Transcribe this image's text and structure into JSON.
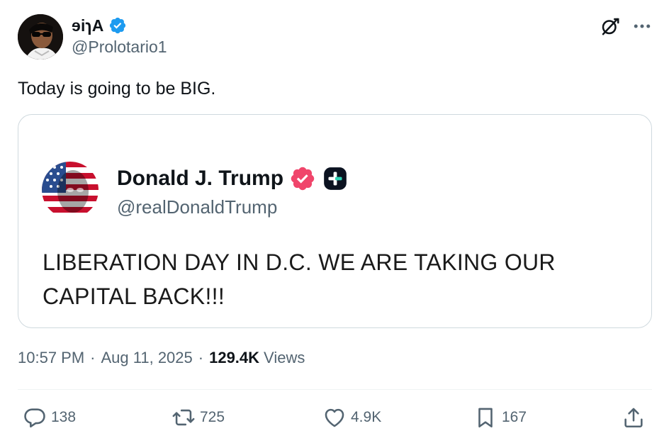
{
  "author": {
    "display_name": "ɘiɿA",
    "handle": "@Prolotario1",
    "verified_color": "#1d9bf0"
  },
  "header_icons": {
    "grok": "grok-icon",
    "more": "more-icon"
  },
  "tweet": {
    "text": "Today is going to be BIG."
  },
  "quoted": {
    "display_name": "Donald J. Trump",
    "handle": "@realDonaldTrump",
    "badge_color": "#f0456b",
    "text": "LIBERATION DAY IN D.C. WE ARE TAKING OUR CAPITAL BACK!!!"
  },
  "meta": {
    "time": "10:57 PM",
    "separator": "·",
    "date": "Aug 11, 2025",
    "views_count": "129.4K",
    "views_label": "Views"
  },
  "actions": {
    "replies": "138",
    "reposts": "725",
    "likes": "4.9K",
    "bookmarks": "167"
  }
}
